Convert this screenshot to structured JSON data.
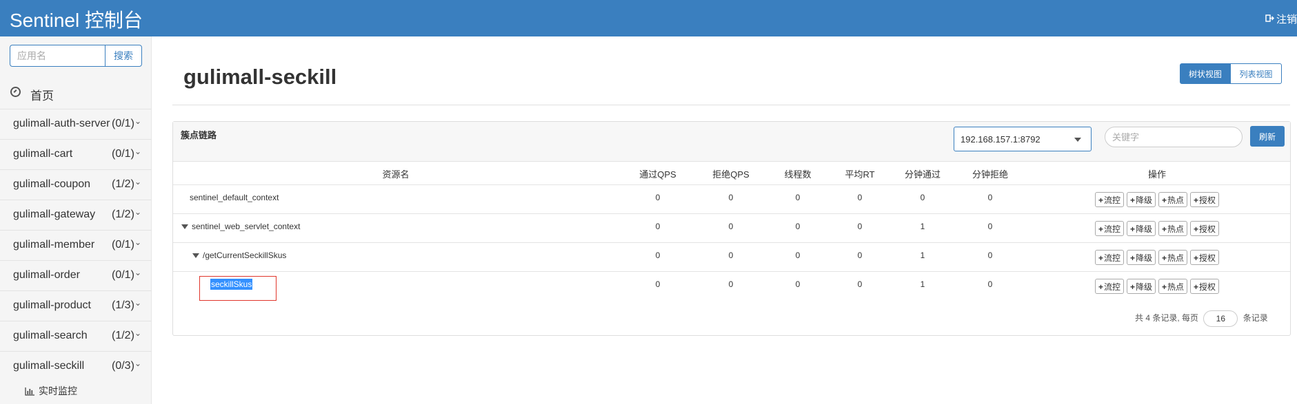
{
  "header": {
    "brand": "Sentinel 控制台",
    "logout": "注销"
  },
  "sidebar": {
    "search": {
      "placeholder": "应用名",
      "button": "搜索"
    },
    "home": "首页",
    "apps": [
      {
        "name": "gulimall-auth-server",
        "count": "(0/1)"
      },
      {
        "name": "gulimall-cart",
        "count": "(0/1)"
      },
      {
        "name": "gulimall-coupon",
        "count": "(1/2)"
      },
      {
        "name": "gulimall-gateway",
        "count": "(1/2)"
      },
      {
        "name": "gulimall-member",
        "count": "(0/1)"
      },
      {
        "name": "gulimall-order",
        "count": "(0/1)"
      },
      {
        "name": "gulimall-product",
        "count": "(1/3)"
      },
      {
        "name": "gulimall-search",
        "count": "(1/2)"
      },
      {
        "name": "gulimall-seckill",
        "count": "(0/3)"
      }
    ],
    "subitem": "实时监控"
  },
  "main": {
    "title": "gulimall-seckill",
    "view_tree": "树状视图",
    "view_list": "列表视图",
    "panel_title": "簇点链路",
    "machine": "192.168.157.1:8792",
    "keyword_placeholder": "关键字",
    "refresh": "刷新",
    "columns": [
      "资源名",
      "通过QPS",
      "拒绝QPS",
      "线程数",
      "平均RT",
      "分钟通过",
      "分钟拒绝",
      "操作"
    ],
    "ops": [
      "流控",
      "降级",
      "热点",
      "授权"
    ],
    "rows": [
      {
        "name": "sentinel_default_context",
        "pass": "0",
        "block": "0",
        "threads": "0",
        "rt": "0",
        "mpass": "0",
        "mblock": "0"
      },
      {
        "name": "sentinel_web_servlet_context",
        "pass": "0",
        "block": "0",
        "threads": "0",
        "rt": "0",
        "mpass": "1",
        "mblock": "0"
      },
      {
        "name": "/getCurrentSeckillSkus",
        "pass": "0",
        "block": "0",
        "threads": "0",
        "rt": "0",
        "mpass": "1",
        "mblock": "0"
      },
      {
        "name": "seckillSkus",
        "pass": "0",
        "block": "0",
        "threads": "0",
        "rt": "0",
        "mpass": "1",
        "mblock": "0"
      }
    ],
    "pager": {
      "prefix": "共 4 条记录, 每页",
      "page_size": "16",
      "suffix": "条记录"
    }
  }
}
